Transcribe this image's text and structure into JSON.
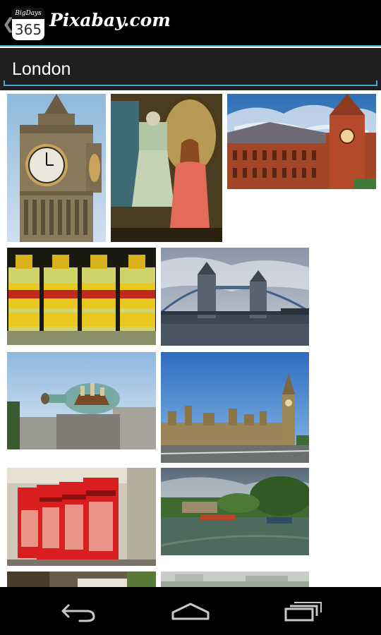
{
  "app": {
    "icon_top_text": "BigDays",
    "icon_number": "365",
    "title": "Pixabay.com"
  },
  "search": {
    "value": "London"
  },
  "images": [
    {
      "name": "big-ben-clock-tower-photo"
    },
    {
      "name": "vintage-shop-mannequins-photo"
    },
    {
      "name": "st-pancras-station-photo"
    },
    {
      "name": "gordons-gin-bottles-photo"
    },
    {
      "name": "tower-bridge-photo"
    },
    {
      "name": "ship-in-bottle-sculpture-photo"
    },
    {
      "name": "palace-of-westminster-photo"
    },
    {
      "name": "red-telephone-boxes-photo"
    },
    {
      "name": "canal-with-narrowboats-photo"
    },
    {
      "name": "london-street-scene-photo"
    },
    {
      "name": "blurred-landscape-photo"
    }
  ],
  "nav": {
    "back_icon": "back-icon",
    "home_icon": "home-icon",
    "recents_icon": "recent-apps-icon"
  }
}
